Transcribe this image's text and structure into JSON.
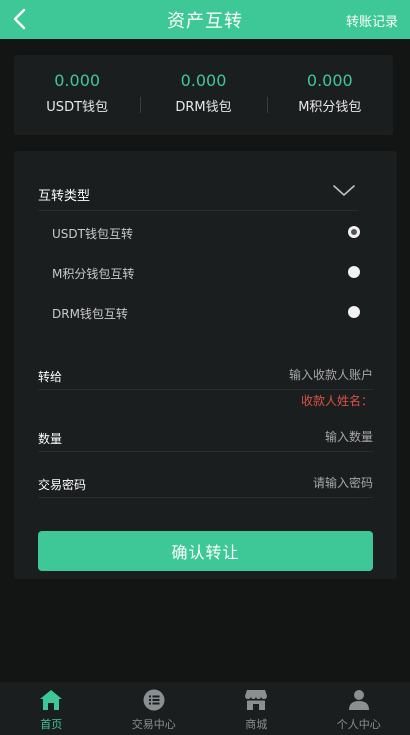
{
  "header": {
    "title": "资产互转",
    "right_link": "转账记录"
  },
  "balances": [
    {
      "value": "0.000",
      "label": "USDT钱包"
    },
    {
      "value": "0.000",
      "label": "DRM钱包"
    },
    {
      "value": "0.000",
      "label": "M积分钱包"
    }
  ],
  "transfer_type": {
    "title": "互转类型",
    "options": [
      {
        "label": "USDT钱包互转",
        "checked": true
      },
      {
        "label": "M积分钱包互转",
        "checked": false
      },
      {
        "label": "DRM钱包互转",
        "checked": false
      }
    ]
  },
  "form": {
    "to_label": "转给",
    "to_placeholder": "输入收款人账户",
    "payee_name": "收款人姓名：",
    "amount_label": "数量",
    "amount_placeholder": "输入数量",
    "password_label": "交易密码",
    "password_placeholder": "请输入密码",
    "submit_label": "确认转让"
  },
  "tabbar": [
    {
      "label": "首页",
      "icon": "home-icon",
      "active": true
    },
    {
      "label": "交易中心",
      "icon": "list-icon",
      "active": false
    },
    {
      "label": "商城",
      "icon": "shop-icon",
      "active": false
    },
    {
      "label": "个人中心",
      "icon": "user-icon",
      "active": false
    }
  ],
  "colors": {
    "accent": "#3fc897",
    "background": "#131515",
    "card": "#1b1e1f",
    "warning": "#d8524a"
  }
}
